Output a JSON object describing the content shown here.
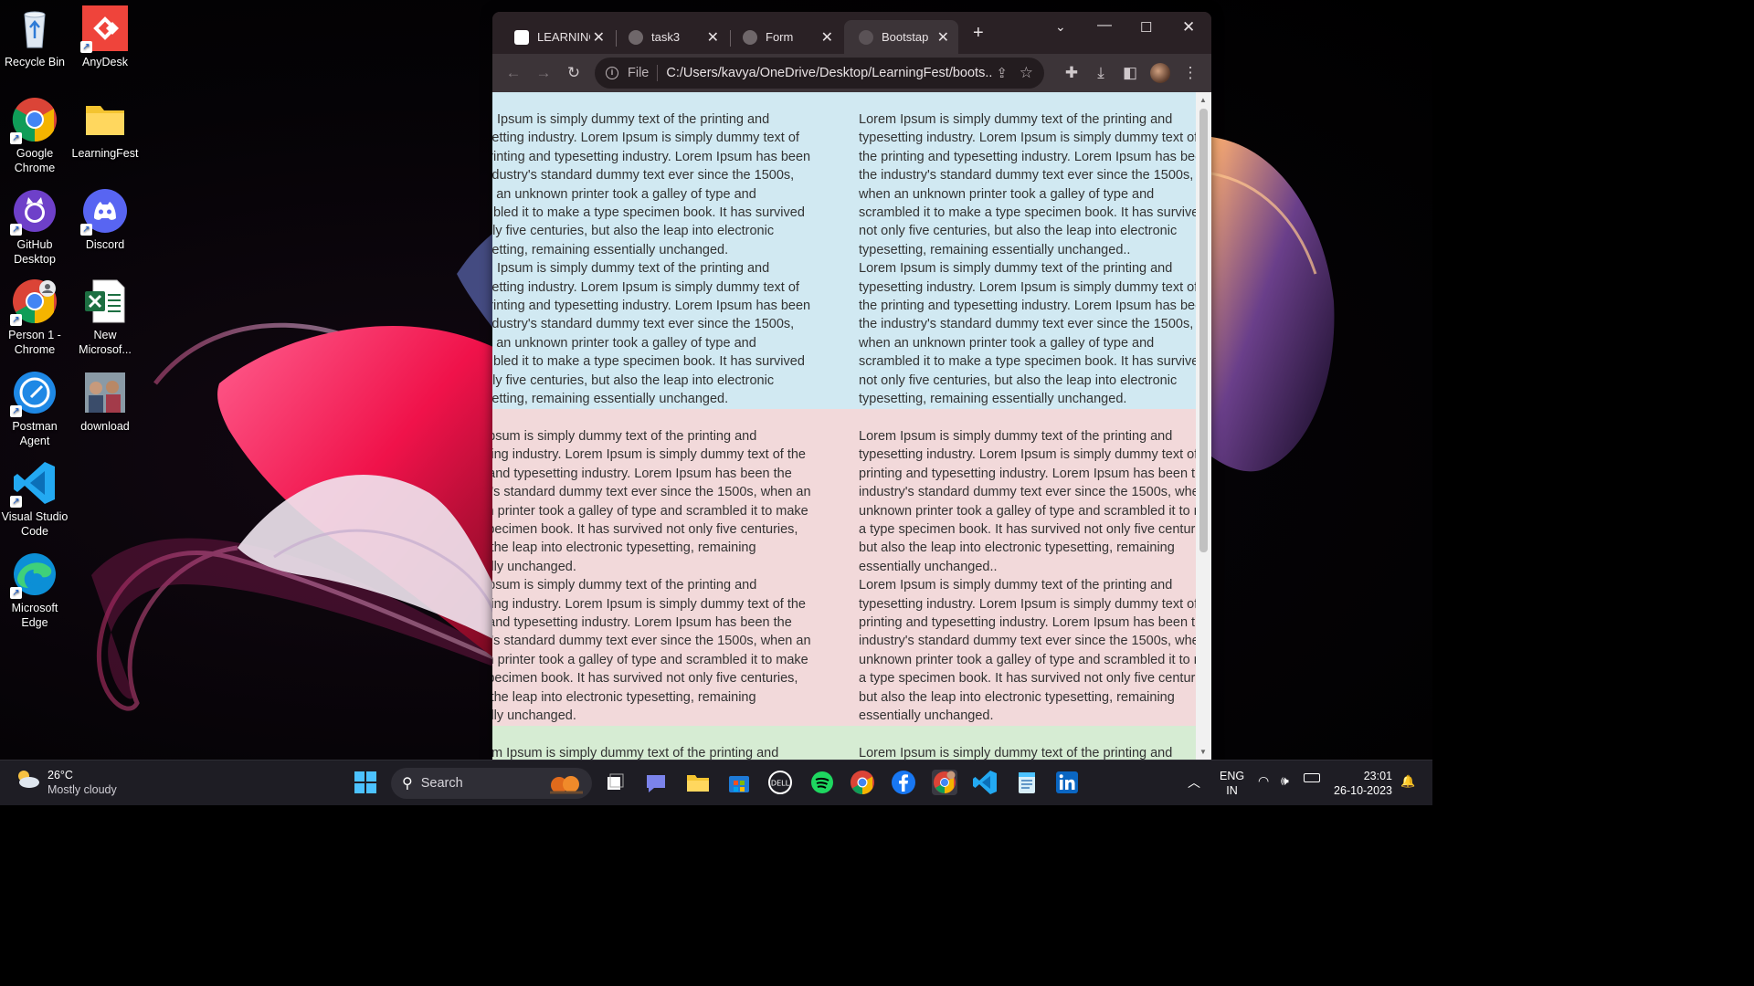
{
  "desktop": {
    "icons": [
      {
        "label": "Recycle Bin",
        "icon": "recycle-bin-icon"
      },
      {
        "label": "AnyDesk",
        "icon": "anydesk-icon"
      },
      {
        "label": "Google Chrome",
        "icon": "chrome-icon"
      },
      {
        "label": "LearningFest",
        "icon": "folder-icon"
      },
      {
        "label": "GitHub Desktop",
        "icon": "github-icon"
      },
      {
        "label": "Discord",
        "icon": "discord-icon"
      },
      {
        "label": "Person 1 - Chrome",
        "icon": "chrome-profile-icon"
      },
      {
        "label": "New Microsof...",
        "icon": "excel-icon"
      },
      {
        "label": "Postman Agent",
        "icon": "postman-icon"
      },
      {
        "label": "download",
        "icon": "photo-thumbnail-icon"
      },
      {
        "label": "Visual Studio Code",
        "icon": "vscode-icon"
      },
      {
        "label": "Microsoft Edge",
        "icon": "edge-icon"
      }
    ]
  },
  "browser": {
    "tabs": [
      {
        "label": "LEARNING",
        "active": false
      },
      {
        "label": "task3",
        "active": false
      },
      {
        "label": "Form",
        "active": false
      },
      {
        "label": "Bootstap",
        "active": true
      }
    ],
    "address": {
      "scheme_label": "File",
      "url": "C:/Users/kavya/OneDrive/Desktop/LearningFest/boots..."
    }
  },
  "page": {
    "blue_left": [
      "rem Ipsum is simply dummy text of the printing and\npesetting industry. Lorem Ipsum is simply dummy text of\ne printing and typesetting industry. Lorem Ipsum has been\ne industry's standard dummy text ever since the 1500s,\nhen an unknown printer took a galley of type and\nrambled it to make a type specimen book. It has survived\nt only five centuries, but also the leap into electronic\npesetting, remaining essentially unchanged.",
      "rem Ipsum is simply dummy text of the printing and\npesetting industry. Lorem Ipsum is simply dummy text of\ne printing and typesetting industry. Lorem Ipsum has been\ne industry's standard dummy text ever since the 1500s,\nhen an unknown printer took a galley of type and\nrambled it to make a type specimen book. It has survived\nt only five centuries, but also the leap into electronic\npesetting, remaining essentially unchanged."
    ],
    "blue_right": [
      "Lorem Ipsum is simply dummy text of the printing and\ntypesetting industry. Lorem Ipsum is simply dummy text of\nthe printing and typesetting industry. Lorem Ipsum has bee\nthe industry's standard dummy text ever since the 1500s,\nwhen an unknown printer took a galley of type and\nscrambled it to make a type specimen book. It has survive\nnot only five centuries, but also the leap into electronic\ntypesetting, remaining essentially unchanged..",
      "Lorem Ipsum is simply dummy text of the printing and\ntypesetting industry. Lorem Ipsum is simply dummy text of\nthe printing and typesetting industry. Lorem Ipsum has bee\nthe industry's standard dummy text ever since the 1500s,\nwhen an unknown printer took a galley of type and\nscrambled it to make a type specimen book. It has survive\nnot only five centuries, but also the leap into electronic\ntypesetting, remaining essentially unchanged."
    ],
    "pink_left": [
      "m Ipsum is simply dummy text of the printing and\nsetting industry. Lorem Ipsum is simply dummy text of the\nng and typesetting industry. Lorem Ipsum has been the\nstry's standard dummy text ever since the 1500s, when an\nown printer took a galley of type and scrambled it to make\ne specimen book. It has survived not only five centuries,\nlso the leap into electronic typesetting, remaining\nntially unchanged.",
      "m Ipsum is simply dummy text of the printing and\nsetting industry. Lorem Ipsum is simply dummy text of the\nng and typesetting industry. Lorem Ipsum has been the\nstry's standard dummy text ever since the 1500s, when an\nown printer took a galley of type and scrambled it to make\ne specimen book. It has survived not only five centuries,\nlso the leap into electronic typesetting, remaining\nntially unchanged."
    ],
    "pink_right": [
      "Lorem Ipsum is simply dummy text of the printing and\ntypesetting industry. Lorem Ipsum is simply dummy text of\nprinting and typesetting industry. Lorem Ipsum has been th\nindustry's standard dummy text ever since the 1500s, whe\nunknown printer took a galley of type and scrambled it to m\na type specimen book. It has survived not only five centurie\nbut also the leap into electronic typesetting, remaining\nessentially unchanged..",
      "Lorem Ipsum is simply dummy text of the printing and\ntypesetting industry. Lorem Ipsum is simply dummy text of\nprinting and typesetting industry. Lorem Ipsum has been th\nindustry's standard dummy text ever since the 1500s, whe\nunknown printer took a galley of type and scrambled it to m\na type specimen book. It has survived not only five centurie\nbut also the leap into electronic typesetting, remaining\nessentially unchanged."
    ],
    "green_left": "m Ipsum is simply dummy text of the printing and",
    "green_right": "Lorem Ipsum is simply dummy text of the printing and"
  },
  "taskbar": {
    "weather": {
      "temp": "26°C",
      "condition": "Mostly cloudy"
    },
    "search_label": "Search",
    "language": {
      "line1": "ENG",
      "line2": "IN"
    },
    "time": "23:01",
    "date": "26-10-2023"
  },
  "colors": {
    "row_blue": "#d1e9f2",
    "row_pink": "#f2d9da",
    "row_green": "#d6ecd3"
  }
}
